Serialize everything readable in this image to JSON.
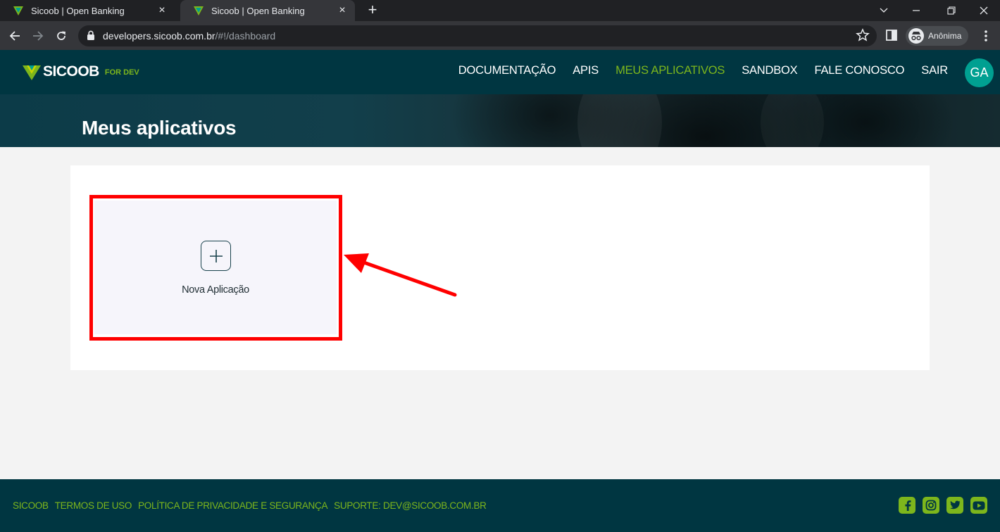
{
  "browser": {
    "tabs": [
      {
        "title": "Sicoob | Open Banking",
        "active": false
      },
      {
        "title": "Sicoob | Open Banking",
        "active": true
      }
    ],
    "url_host": "developers.sicoob.com.br",
    "url_path": "/#!/dashboard",
    "profile_label": "Anônima"
  },
  "site": {
    "brand": "SICOOB",
    "brand_suffix": "FOR DEV",
    "menu": [
      {
        "label": "DOCUMENTAÇÃO",
        "current": false
      },
      {
        "label": "APIS",
        "current": false
      },
      {
        "label": "MEUS APLICATIVOS",
        "current": true
      },
      {
        "label": "SANDBOX",
        "current": false
      },
      {
        "label": "FALE CONOSCO",
        "current": false
      },
      {
        "label": "SAIR",
        "current": false
      }
    ],
    "avatar_initials": "GA"
  },
  "page": {
    "title": "Meus aplicativos",
    "new_app_label": "Nova Aplicação"
  },
  "footer": {
    "links": [
      "SICOOB",
      "TERMOS DE USO",
      "POLÍTICA DE PRIVACIDADE E SEGURANÇA",
      "SUPORTE: DEV@SICOOB.COM.BR"
    ],
    "socials": [
      "facebook-icon",
      "instagram-icon",
      "twitter-icon",
      "youtube-icon"
    ]
  },
  "colors": {
    "header_bg": "#003641",
    "accent_green": "#7db61c",
    "avatar_teal": "#00a091",
    "annotation_red": "#ff0000"
  }
}
